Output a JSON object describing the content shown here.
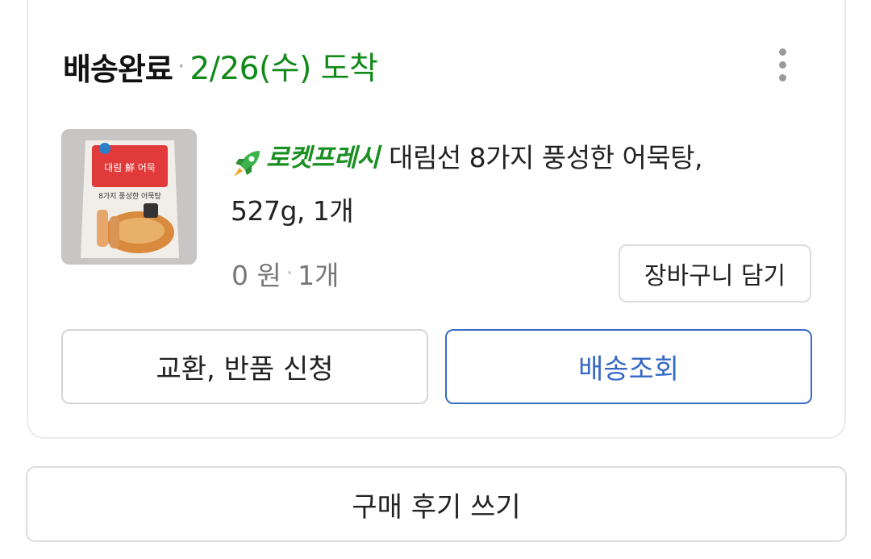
{
  "order": {
    "status": "배송완료",
    "separator": "·",
    "arrival": "2/26(수) 도착"
  },
  "product": {
    "badge": "로켓프레시",
    "name_line1": "대림선 8가지 풍성한 어묵탕,",
    "name_line2": "527g, 1개",
    "price": "0 원",
    "price_separator": "·",
    "quantity": "1개",
    "package_brand": "대림 鮮 어묵",
    "package_title": "8가지 풍성한 어묵탕"
  },
  "actions": {
    "add_to_cart": "장바구니 담기",
    "exchange_return": "교환, 반품 신청",
    "track_delivery": "배송조회",
    "write_review": "구매 후기 쓰기"
  },
  "icons": {
    "more": "more-vertical-icon",
    "badge": "rocket-icon"
  },
  "colors": {
    "arrival_green": "#118a1a",
    "badge_green": "#1a8f22",
    "track_blue": "#3468c4"
  }
}
